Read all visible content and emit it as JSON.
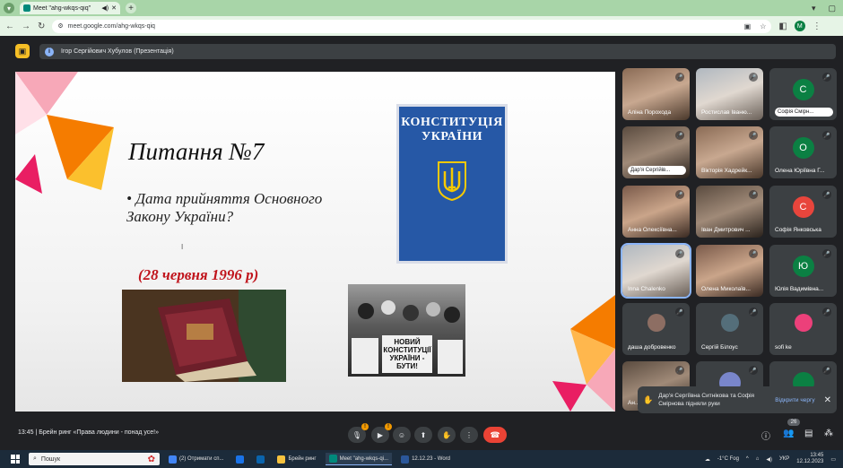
{
  "browser": {
    "tab_title": "Meet \"ahg-wkqs-qiq\"",
    "url": "meet.google.com/ahg-wkqs-qiq",
    "profile_initial": "M"
  },
  "meet": {
    "presenter_label": "Ігор Сергійович Хубулов (Презентація)",
    "meeting_time": "13:45",
    "meeting_name": "Брейн ринг «Права людини - понад усе!»",
    "people_count": "26"
  },
  "slide": {
    "title": "Питання №7",
    "bullet": "• Дата прийняття Основного Закону України?",
    "answer": "(28 червня 1996 р)",
    "book_line1": "КОНСТИТУЦІЯ",
    "book_line2": "УКРАЇНИ",
    "sign_text": "НОВИЙ КОНСТИТУЦІЇ УКРАЇНИ - БУТИ!",
    "cursor": "I"
  },
  "participants": [
    {
      "name": "Аліна Порохода",
      "type": "video"
    },
    {
      "name": "Ростислав Іваню...",
      "type": "video"
    },
    {
      "name": "Софія Смірн...",
      "type": "avatar",
      "initial": "С",
      "color": "#0b8043",
      "pill": true
    },
    {
      "name": "Дар'я Сергійів...",
      "type": "video",
      "pill": true
    },
    {
      "name": "Вікторія Хадрейк...",
      "type": "video"
    },
    {
      "name": "Олена Юріївна Г...",
      "type": "avatar",
      "initial": "О",
      "color": "#0b8043"
    },
    {
      "name": "Анна Олексіївна...",
      "type": "video"
    },
    {
      "name": "Іван Дмитрович ...",
      "type": "video"
    },
    {
      "name": "Софія Янковська",
      "type": "avatar",
      "initial": "С",
      "color": "#e8453c"
    },
    {
      "name": "Inna Chalenko",
      "type": "video"
    },
    {
      "name": "Олена Миколаїв...",
      "type": "video"
    },
    {
      "name": "Юлія Вадимівна...",
      "type": "avatar",
      "initial": "Ю",
      "color": "#0b8043"
    },
    {
      "name": "даша добровенко",
      "type": "photo"
    },
    {
      "name": "Сергій Білоус",
      "type": "photo"
    },
    {
      "name": "sofi ke",
      "type": "photo"
    },
    {
      "name": "Ан...",
      "type": "video"
    },
    {
      "name": "",
      "type": "avatar",
      "initial": "",
      "color": "#7986cb"
    },
    {
      "name": "",
      "type": "avatar",
      "initial": "",
      "color": "#0b8043"
    }
  ],
  "toast": {
    "message": "Дар'я Сергіївна Ситнікова та Софія Смірнова підняли руки",
    "action": "Відкрити чергу"
  },
  "taskbar": {
    "search_placeholder": "Пошук",
    "items": [
      "(2) Отримати сп...",
      "",
      "",
      "Брейн ринг",
      "Meet \"ahg-wkqs-qi...",
      "12.12.23 - Word"
    ],
    "weather": "-1°C Fog",
    "lang": "УКР",
    "time": "13:45",
    "date": "12.12.2023"
  },
  "colors": {
    "meet_bg": "#202124",
    "tile_bg": "#3c4043",
    "end_call": "#ea4335",
    "accent": "#8ab4f8",
    "answer_red": "#c0141c",
    "book_blue": "#2658a6"
  }
}
